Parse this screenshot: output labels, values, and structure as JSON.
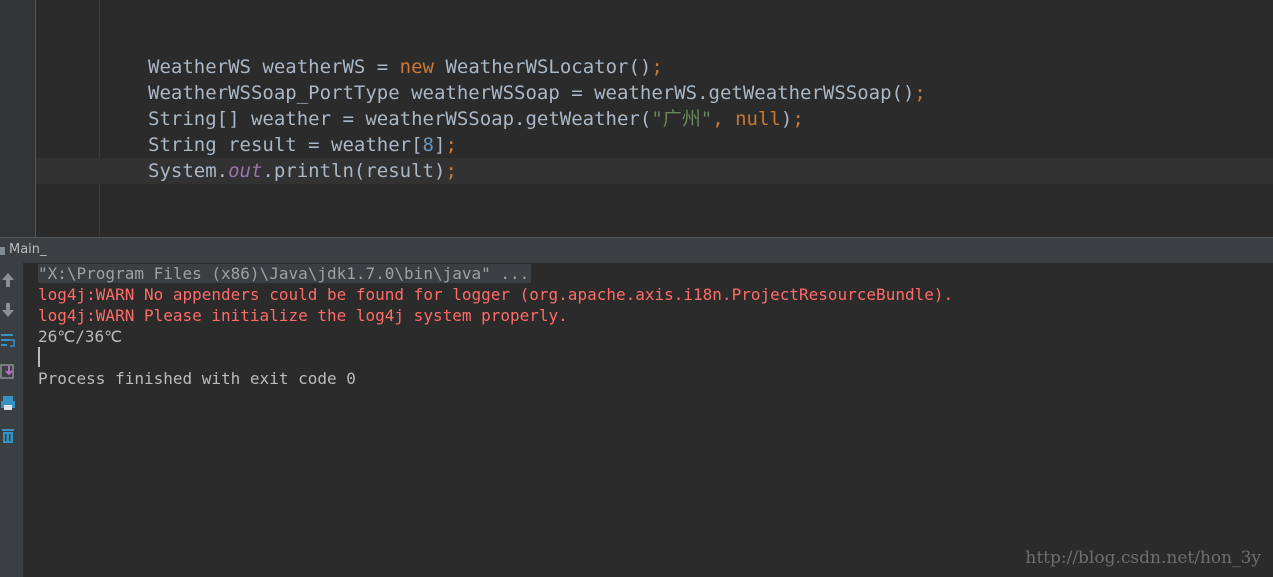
{
  "editor": {
    "lines": [
      [
        "WeatherWS weatherWS = ",
        "new",
        " WeatherWSLocator()",
        ";"
      ],
      [
        "WeatherWSSoap_PortType weatherWSSoap = weatherWS.getWeatherWSSoap()",
        ";"
      ],
      [
        "String[] weather = weatherWSSoap.getWeather(",
        "\"广州\"",
        ", ",
        "null",
        ")",
        ";"
      ],
      [
        "String result = weather[",
        "8",
        "]",
        ";"
      ],
      [
        "System.",
        "out",
        ".println(result)",
        ";"
      ]
    ]
  },
  "run_panel": {
    "tab_label": "Main_",
    "toolbar_icons": [
      "up-arrow-icon",
      "down-arrow-icon",
      "soft-wrap-icon",
      "scroll-to-end-icon",
      "print-icon",
      "clear-trash-icon"
    ],
    "console": {
      "command": "\"X:\\Program Files (x86)\\Java\\jdk1.7.0\\bin\\java\" ...",
      "warn1": "log4j:WARN No appenders could be found for logger (org.apache.axis.i18n.ProjectResourceBundle).",
      "warn2": "log4j:WARN Please initialize the log4j system properly.",
      "result": "26℃/36℃",
      "exit": "Process finished with exit code 0"
    }
  },
  "watermark": "http://blog.csdn.net/hon_3y",
  "colors": {
    "background": "#2b2b2b",
    "keyword": "#cc7832",
    "string": "#6a8759",
    "number": "#6897bb",
    "field": "#9876aa",
    "error": "#ff6b68"
  }
}
